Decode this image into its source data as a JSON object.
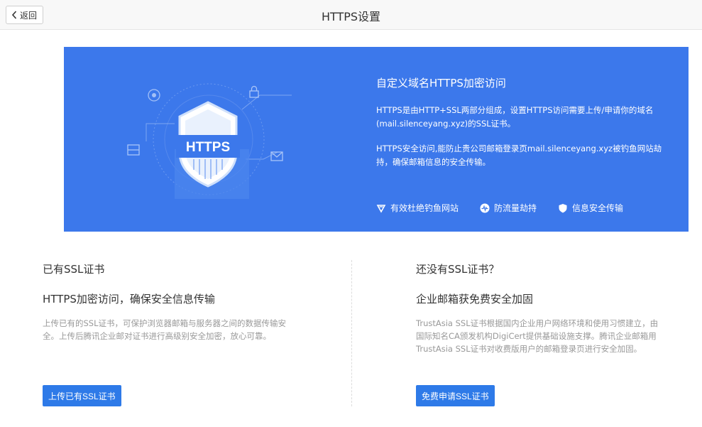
{
  "header": {
    "back_label": "返回",
    "title": "HTTPS设置"
  },
  "banner": {
    "badge_text": "HTTPS",
    "title": "自定义域名HTTPS加密访问",
    "paragraph1": "HTTPS是由HTTP+SSL两部分组成，设置HTTPS访问需要上传/申请你的域名(mail.silenceyang.xyz)的SSL证书。",
    "paragraph2": "HTTPS安全访问,能防止贵公司邮箱登录页mail.silenceyang.xyz被钓鱼网站劫持，确保邮箱信息的安全传输。",
    "features": [
      {
        "label": "有效杜绝钓鱼网站",
        "icon": "filter-icon"
      },
      {
        "label": "防流量劫持",
        "icon": "pulse-icon"
      },
      {
        "label": "信息安全传输",
        "icon": "shield-icon"
      }
    ],
    "bg_color": "#3c78eb"
  },
  "left": {
    "heading": "已有SSL证书",
    "subheading": "HTTPS加密访问，确保安全信息传输",
    "description": "上传已有的SSL证书，可保护浏览器邮箱与服务器之间的数据传输安全。上传后腾讯企业邮对证书进行高级别安全加密，放心可靠。",
    "button_label": "上传已有SSL证书"
  },
  "right": {
    "heading": "还没有SSL证书？",
    "subheading": "企业邮箱获免费安全加固",
    "description": "TrustAsia SSL证书根据国内企业用户网络环境和使用习惯建立，由国际知名CA颁发机构DigiCert提供基础设施支撑。腾讯企业邮箱用TrustAsia SSL证书对收费版用户的邮箱登录页进行安全加固。",
    "button_label": "免费申请SSL证书"
  },
  "colors": {
    "accent": "#2e7ae8"
  }
}
